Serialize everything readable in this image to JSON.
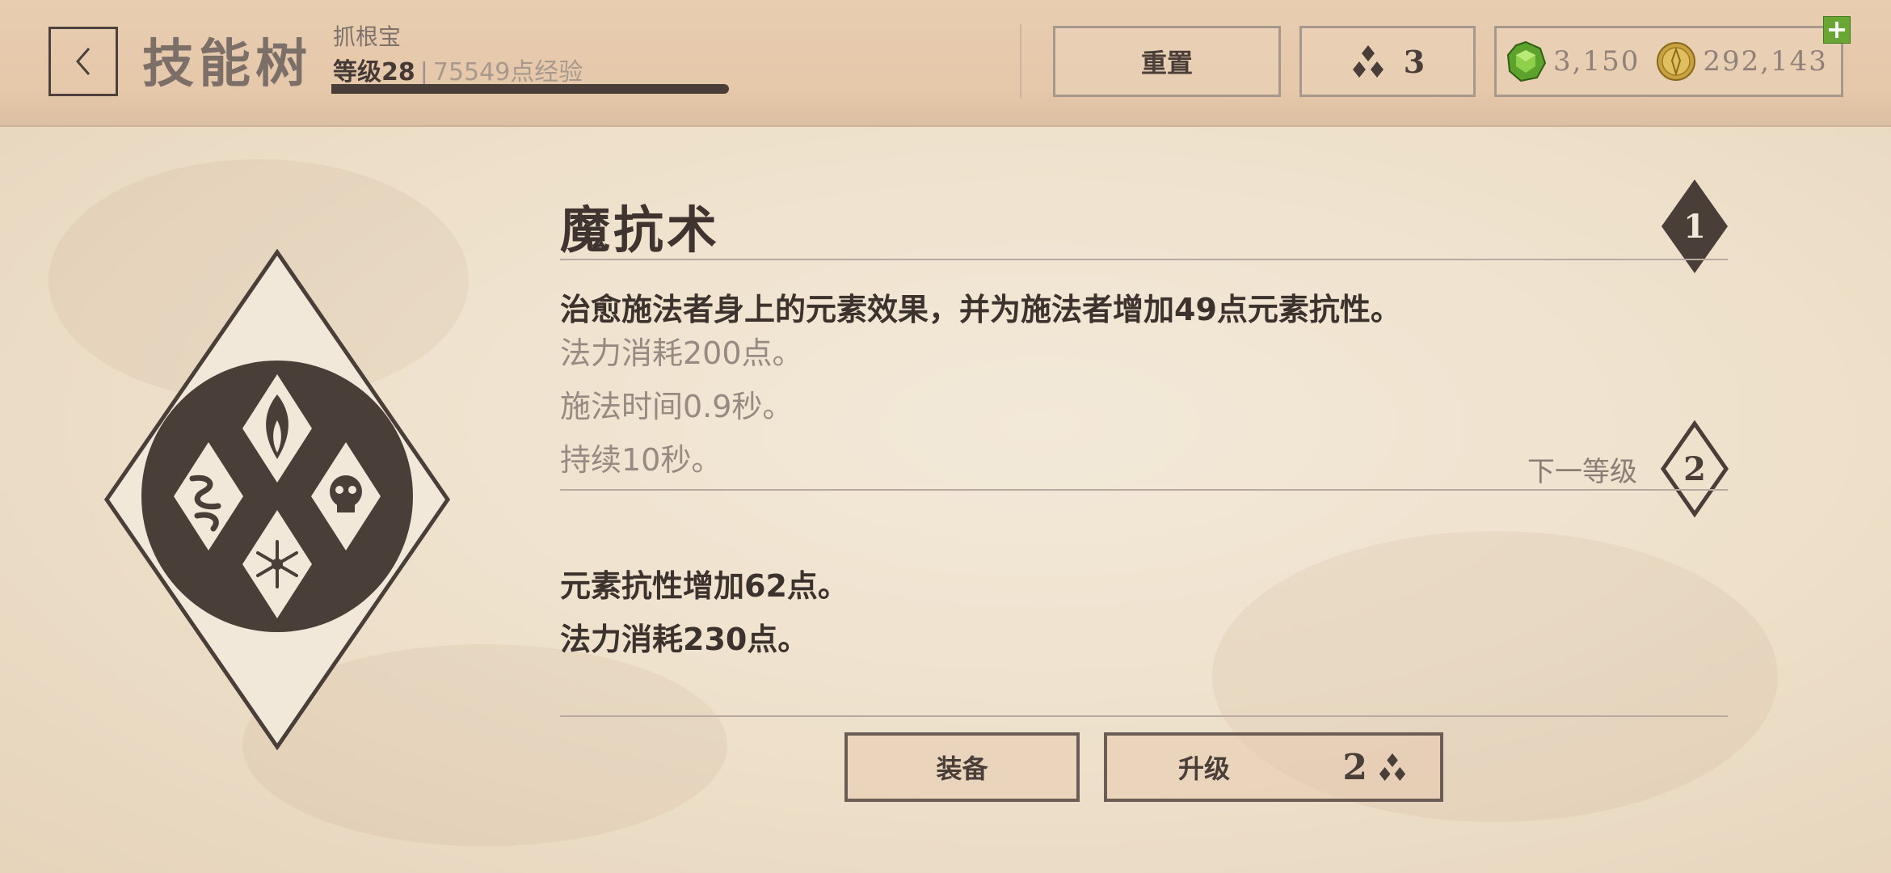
{
  "header": {
    "title": "技能树",
    "player_name": "抓根宝",
    "level_label": "等级28",
    "xp_label": "75549点经验",
    "reset_label": "重置",
    "skill_points": "3",
    "gems": "3,150",
    "gold": "292,143",
    "add_label": "+"
  },
  "skill": {
    "name": "魔抗术",
    "rank": "1",
    "description": "治愈施法者身上的元素效果，并为施法者增加49点元素抗性。",
    "stats": [
      "法力消耗200点。",
      "施法时间0.9秒。",
      "持续10秒。"
    ],
    "next_level_label": "下一等级",
    "next_rank": "2",
    "next_stats": [
      "元素抗性增加62点。",
      "法力消耗230点。"
    ]
  },
  "actions": {
    "equip_label": "装备",
    "upgrade_label": "升级",
    "upgrade_cost": "2"
  },
  "colors": {
    "ink": "#4a3e39",
    "gem_green": "#5da22c",
    "gold_coin": "#c9a240",
    "parchment": "#efe3cf"
  },
  "icons": [
    "back-arrow-icon",
    "skill-point-icon",
    "gem-icon",
    "gold-coin-icon",
    "elemental-resistance-icon"
  ]
}
